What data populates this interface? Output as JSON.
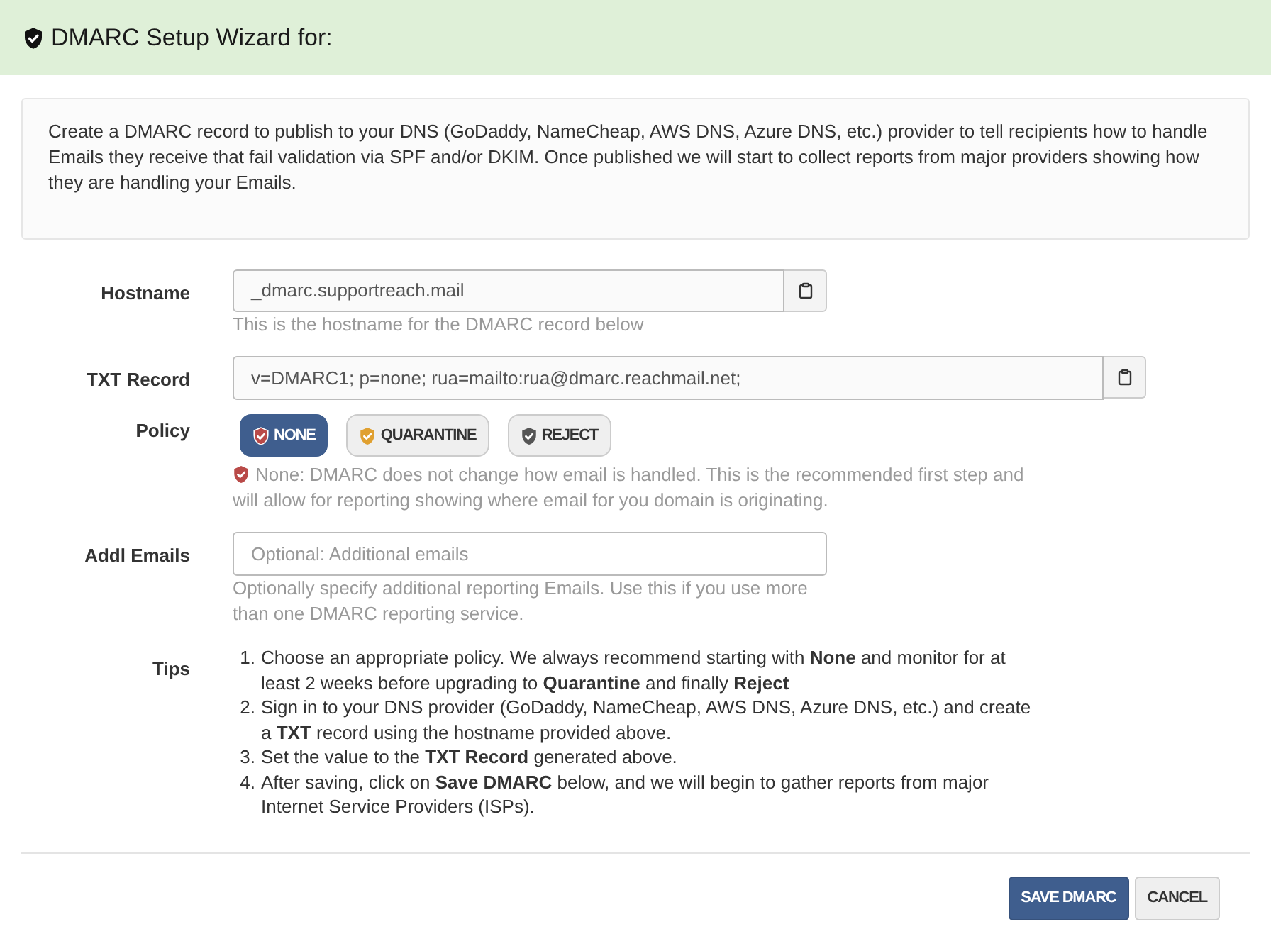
{
  "header": {
    "title": "DMARC Setup Wizard for:"
  },
  "intro": "Create a DMARC record to publish to your DNS (GoDaddy, NameCheap, AWS DNS, Azure DNS, etc.) provider to tell recipients how to handle Emails they receive that fail validation via SPF and/or DKIM. Once published we will start to collect reports from major providers showing how they are handling your Emails.",
  "hostname": {
    "label": "Hostname",
    "value": "_dmarc.supportreach.mail",
    "help": "This is the hostname for the DMARC record below"
  },
  "txt_record": {
    "label": "TXT Record",
    "value": "v=DMARC1; p=none; rua=mailto:rua@dmarc.reachmail.net;"
  },
  "policy": {
    "label": "Policy",
    "options": [
      {
        "label": "NONE",
        "selected": true,
        "color": "#b94a48"
      },
      {
        "label": "QUARANTINE",
        "selected": false,
        "color": "#e0a030"
      },
      {
        "label": "REJECT",
        "selected": false,
        "color": "#555555"
      }
    ],
    "description": "None: DMARC does not change how email is handled. This is the recommended first step and will allow for reporting showing where email for you domain is originating."
  },
  "addl_emails": {
    "label": "Addl Emails",
    "placeholder": "Optional: Additional emails",
    "help": "Optionally specify additional reporting Emails. Use this if you use more than one DMARC reporting service."
  },
  "tips": {
    "label": "Tips",
    "items": [
      {
        "number": "1.",
        "text": "Choose an appropriate policy. We always recommend starting with **None** and monitor for at least 2 weeks before upgrading to **Quarantine** and finally **Reject**"
      },
      {
        "number": "2.",
        "text": "Sign in to your DNS provider (GoDaddy, NameCheap, AWS DNS, Azure DNS, etc.) and create a **TXT** record using the hostname provided above."
      },
      {
        "number": "3.",
        "text": "Set the value to the **TXT Record** generated above."
      },
      {
        "number": "4.",
        "text": "After saving, click on **Save DMARC** below, and we will begin to gather reports from major Internet Service Providers (ISPs)."
      }
    ]
  },
  "buttons": [
    {
      "label": "SAVE DMARC",
      "kind": "primary"
    },
    {
      "label": "CANCEL",
      "kind": "default"
    }
  ]
}
